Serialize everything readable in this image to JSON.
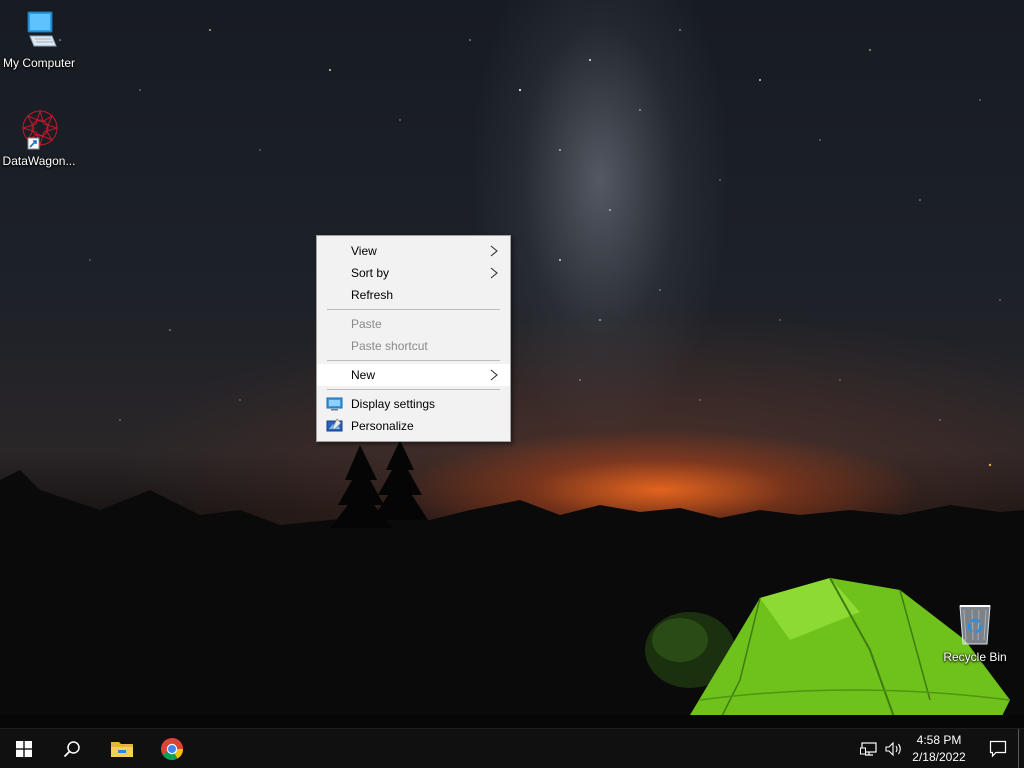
{
  "desktop": {
    "icons": [
      {
        "label": "My Computer",
        "icon": "computer-icon"
      },
      {
        "label": "DataWagon...",
        "icon": "datawagon-icon"
      },
      {
        "label": "Recycle Bin",
        "icon": "recycle-bin-icon"
      }
    ]
  },
  "context_menu": {
    "items": [
      {
        "label": "View",
        "submenu": true,
        "enabled": true
      },
      {
        "label": "Sort by",
        "submenu": true,
        "enabled": true
      },
      {
        "label": "Refresh",
        "submenu": false,
        "enabled": true
      },
      {
        "label": "Paste",
        "submenu": false,
        "enabled": false
      },
      {
        "label": "Paste shortcut",
        "submenu": false,
        "enabled": false
      },
      {
        "label": "New",
        "submenu": true,
        "enabled": true,
        "highlighted": true
      },
      {
        "label": "Display settings",
        "submenu": false,
        "enabled": true,
        "icon": "display-settings-icon"
      },
      {
        "label": "Personalize",
        "submenu": false,
        "enabled": true,
        "icon": "personalize-icon"
      }
    ]
  },
  "taskbar": {
    "buttons": [
      {
        "name": "start",
        "icon": "windows-logo-icon"
      },
      {
        "name": "search",
        "icon": "search-icon"
      },
      {
        "name": "file-explorer",
        "icon": "folder-icon"
      },
      {
        "name": "chrome",
        "icon": "chrome-icon"
      }
    ],
    "tray": {
      "icons": [
        "network-icon",
        "volume-icon",
        "notification-icon"
      ],
      "time": "4:58 PM",
      "date": "2/18/2022"
    }
  },
  "colors": {
    "menu_bg": "#f2f2f2",
    "menu_disabled_text": "#8a8a8a",
    "taskbar_bg": "#101010",
    "tent_green": "#7ed321",
    "horizon_orange": "#ff6e1e"
  }
}
